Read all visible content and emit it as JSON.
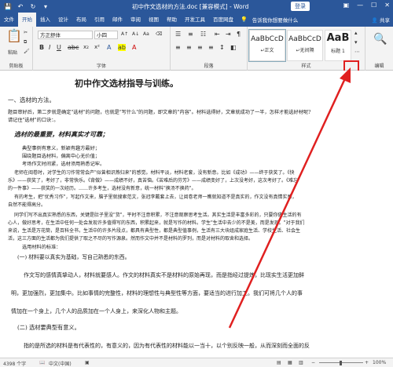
{
  "window": {
    "title": "初中作文选材的方法.doc [兼容模式] - Word",
    "login": "登录"
  },
  "quick_access": [
    "💾",
    "↶",
    "↻",
    "▾"
  ],
  "ribbon_tabs": [
    "文件",
    "开始",
    "插入",
    "设计",
    "布局",
    "引用",
    "邮件",
    "审阅",
    "视图",
    "帮助",
    "开发工具",
    "百度网盘"
  ],
  "tell_me": "告诉我你想要做什么",
  "share": "共享",
  "ribbon": {
    "clipboard": {
      "label": "剪贴板",
      "paste": "粘贴"
    },
    "font": {
      "label": "字体",
      "font_name": "方正舒体",
      "font_size": "小四"
    },
    "paragraph": {
      "label": "段落"
    },
    "styles": {
      "label": "样式",
      "items": [
        {
          "preview": "AaBbCcD",
          "name": "↵正文"
        },
        {
          "preview": "AaBbCcD",
          "name": "↵无间隔"
        },
        {
          "preview": "AaB",
          "name": "标题 1"
        }
      ]
    },
    "editing": {
      "label": "编辑"
    }
  },
  "document": {
    "title": "初中作文选材指导与训练。",
    "lines": [
      "一、选材的方法。",
      "题目审好后，第二步就是确定\"选材\"的问题，也就是\"写什么\"的问题，即文章的\"内容\"。材料选得好，文章就成功了一半，怎样才能选好材呢?",
      "请记住\"选材\"的口诀：。",
      "选材的最重要，材料真实才可靠；",
      "典型事例有意义，新颖有趣方最好；",
      "围绕题目选材料，偏离中心无价值；",
      "考场作文时间紧，选材须用熟悉记牢。",
      "老师在阅卷时，对学生的习作常常会产\"似曾相识燕归来\"的感觉。材料平淡，材料老套，没有新意。比如《成功》——终于获奖了。《快",
      "乐》——获奖了，考好了，非常快乐。《背做》——成绩不好，真苦恼。《苦难后的芬芳》——成绩变好了，上次没考好，这次考好了。《难忘",
      "的一件事》——获奖的一次经历。……许多考生，选材没有新意，统一材料\"换汤不换药\"。",
      "有的考生，把\"优秀习作\"，写起作文来，脑子里就搜索范文，张冠李戴套上去，让阅卷老师一瞧就知道不是真实的，作文没有真情实感，",
      "自然不能得高分。",
      "同学们写不出真实熟悉的东西，关键是肚子里没\"货\"，平时不注意积累，不注意观察思考生活。其实生活是丰富多彩的，只要你做生活的有",
      "心人，做好思考，在生活中任何一处会发现许多值得写的东西，积累起来，就是写作的材料。学生\"生活中去少的不是美，而是发现。\"对于我们",
      "来说，生活是万花筒，是百科全书，生活中的许多片段点，都具有典型性，都是典型值事例，生活有三大块组成家庭生活、学校生活、社会生",
      "活，这三方面的生活都为我们提供了取之不尽的写作源泉。然而作文中并不是材料的罗列，而是对材料的取舍和选择。",
      "选用材料的标准：",
      "(一) 材料要以真实为基础，写自己熟悉的东西。",
      "作文写的感情真挚动人，材料就要感人。作文的材料真实不是材料的原始再现，而是指经过提炼，比现实生活更加鲜",
      "明，更加强烈，更加集中。比如事情的完整性，材料的理想性与典型性等方面，要适当的进行加工。我们可将几个人的事",
      "情加在一个身上，几个人的品质加在一个人身上，来深化人物和主题。",
      "(二) 选材要典型有意义。",
      "指的是所选的材料是有代表性的，有意义的，因为有代表性的材料能以一当十，以个别反映一般，从而深刻而全面的反"
    ]
  },
  "status": {
    "words": "4398 个字",
    "language": "中文(中国)",
    "zoom": "100%"
  }
}
